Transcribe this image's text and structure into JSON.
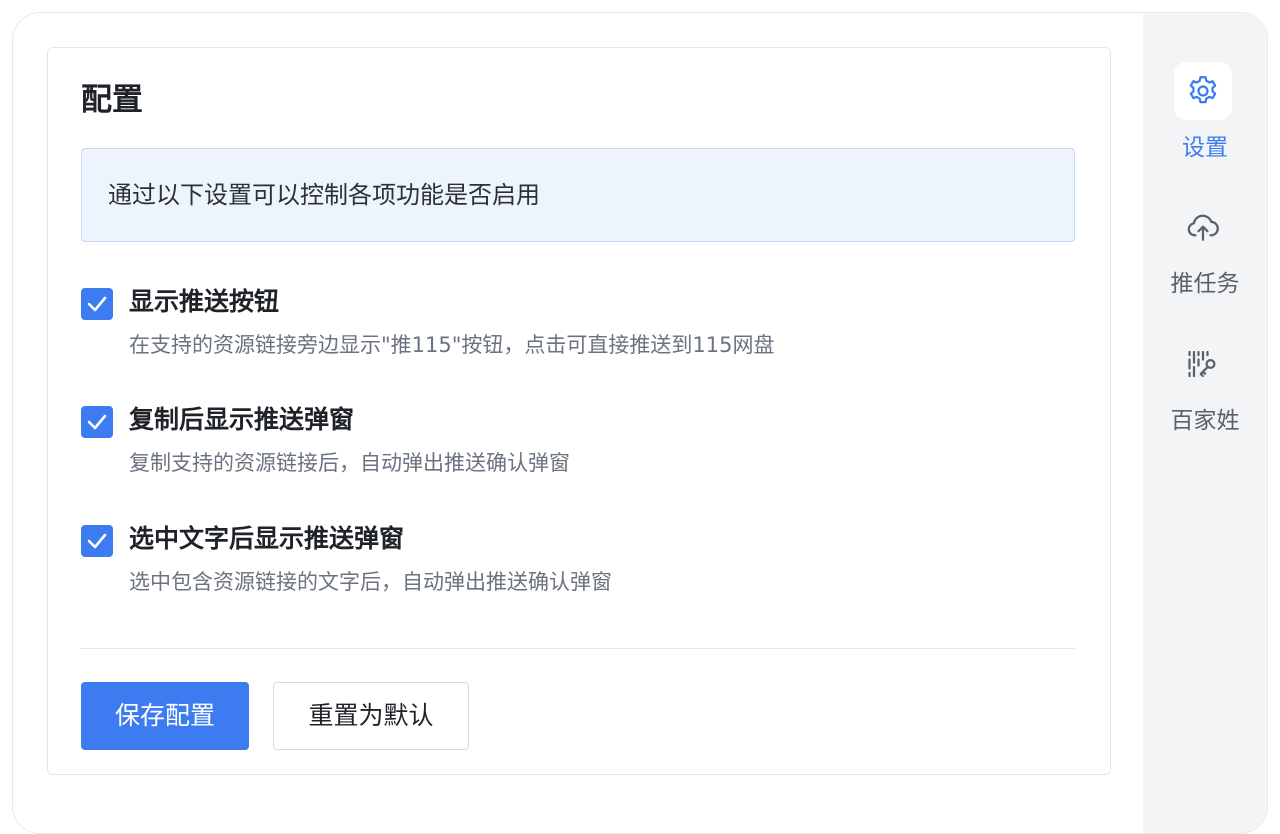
{
  "config": {
    "title": "配置",
    "info": "通过以下设置可以控制各项功能是否启用",
    "options": [
      {
        "title": "显示推送按钮",
        "desc": "在支持的资源链接旁边显示\"推115\"按钮，点击可直接推送到115网盘",
        "checked": true
      },
      {
        "title": "复制后显示推送弹窗",
        "desc": "复制支持的资源链接后，自动弹出推送确认弹窗",
        "checked": true
      },
      {
        "title": "选中文字后显示推送弹窗",
        "desc": "选中包含资源链接的文字后，自动弹出推送确认弹窗",
        "checked": true
      }
    ],
    "save_label": "保存配置",
    "reset_label": "重置为默认"
  },
  "sidebar": {
    "items": [
      {
        "label": "设置",
        "icon": "gear-icon",
        "active": true
      },
      {
        "label": "推任务",
        "icon": "cloud-upload-icon",
        "active": false
      },
      {
        "label": "百家姓",
        "icon": "barcode-key-icon",
        "active": false
      }
    ]
  },
  "colors": {
    "accent": "#3d7cf0",
    "info_bg": "#edf4fd",
    "sidebar_bg": "#f3f4f6"
  }
}
